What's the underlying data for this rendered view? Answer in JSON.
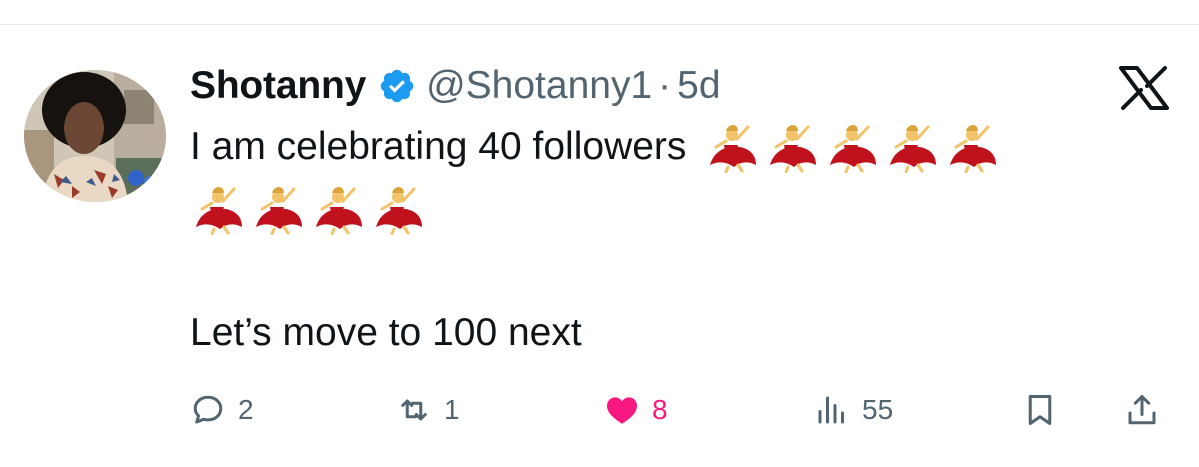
{
  "tweet": {
    "display_name": "Shotanny",
    "handle": "@Shotanny1",
    "separator": "·",
    "time": "5d",
    "line1": "I am celebrating 40 followers",
    "line3": "Let’s move to 100 next",
    "emoji": "dancer-emoji",
    "emoji_count_line1": 5,
    "emoji_count_line2": 4
  },
  "actions": {
    "reply_count": "2",
    "retweet_count": "1",
    "like_count": "8",
    "views_count": "55"
  },
  "colors": {
    "text": "#0f1419",
    "secondary": "#536471",
    "verified": "#1d9bf0",
    "like": "#f91880",
    "divider": "#e6e9ec"
  },
  "icons": [
    "reply-icon",
    "retweet-icon",
    "like-icon",
    "views-icon",
    "bookmark-icon",
    "share-icon",
    "verified-badge-icon",
    "x-logo-icon"
  ]
}
